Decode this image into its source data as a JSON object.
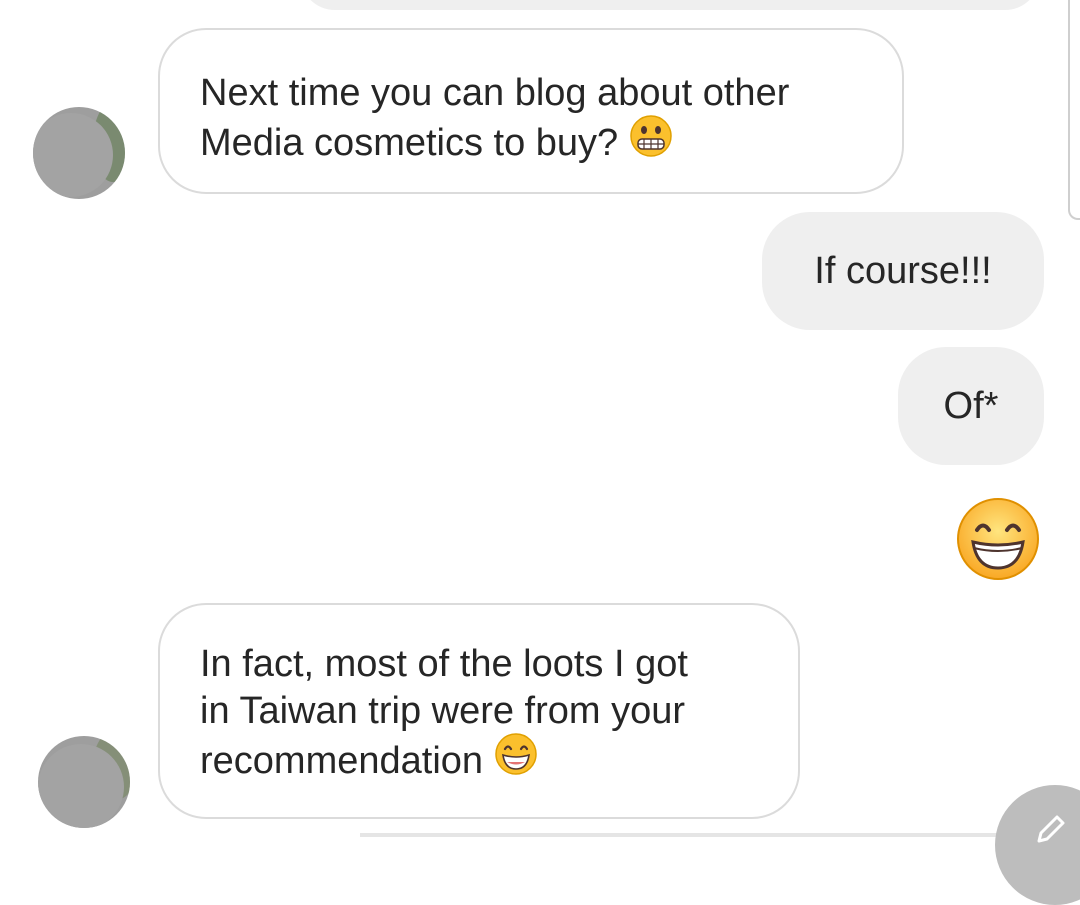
{
  "messages": [
    {
      "from": "other",
      "text": "Next time you can blog about other Media cosmetics to buy?",
      "line1": "Next time you can blog about other",
      "line2": "Media cosmetics to buy?",
      "emoji": "grimacing-face"
    },
    {
      "from": "me",
      "text": "If course!!!"
    },
    {
      "from": "me",
      "text": "Of*"
    },
    {
      "from": "me",
      "emoji": "grinning-face-with-smiling-eyes"
    },
    {
      "from": "other",
      "line1": "In fact, most of the loots I got",
      "line2": "in Taiwan trip were from your",
      "line3": "recommendation",
      "emoji": "grinning-face-with-smiling-eyes"
    }
  ],
  "colors": {
    "received_bubble_border": "#dbdbdb",
    "sent_bubble_bg": "#efefef",
    "text": "#262626",
    "emoji_yellow": "#fbc02d"
  },
  "icons": {
    "fab": "pencil-icon"
  }
}
